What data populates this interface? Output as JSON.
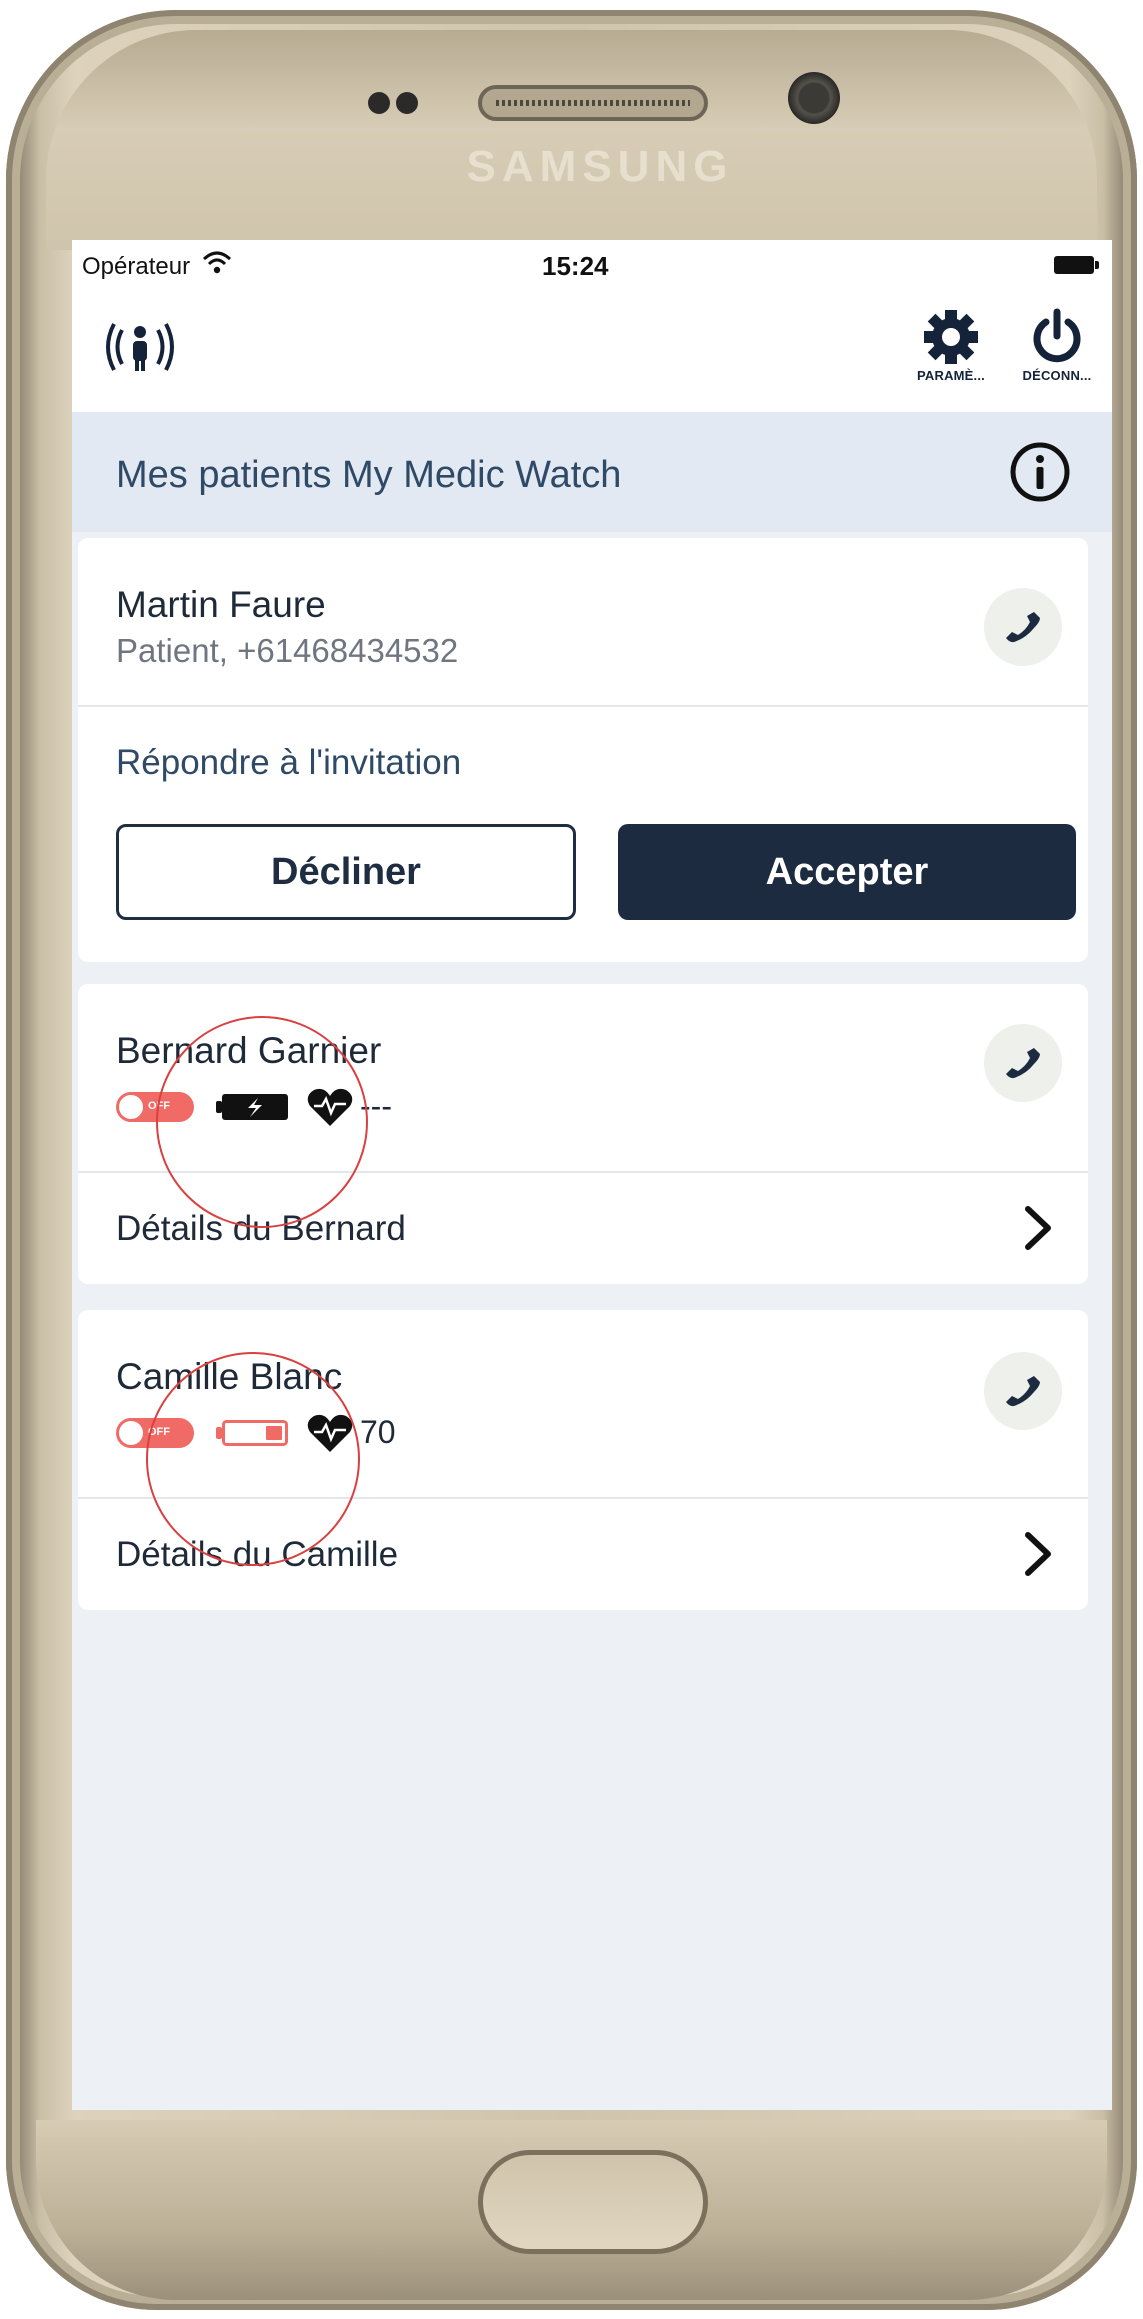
{
  "device": {
    "brand": "SAMSUNG"
  },
  "status_bar": {
    "carrier": "Opérateur",
    "time": "15:24"
  },
  "navbar": {
    "settings_caption": "PARAMÈ...",
    "logout_caption": "DÉCONN..."
  },
  "section": {
    "title": "Mes patients My Medic Watch"
  },
  "invitation": {
    "name": "Martin Faure",
    "subtitle": "Patient, +61468434532",
    "prompt": "Répondre à l'invitation",
    "decline_label": "Décliner",
    "accept_label": "Accepter"
  },
  "patients": [
    {
      "name": "Bernard Garnier",
      "watch_status": "OFF",
      "battery": "charging",
      "heart_rate": "---",
      "details_label": "Détails du Bernard"
    },
    {
      "name": "Camille Blanc",
      "watch_status": "OFF",
      "battery": "low",
      "heart_rate": "70",
      "details_label": "Détails du Camille"
    }
  ],
  "colors": {
    "primary_dark": "#1d2b41",
    "header_bg": "#e3e9f2",
    "screen_bg": "#edf1f6",
    "alert_red": "#f06a66",
    "annotation_red": "#d94040"
  },
  "icons": [
    "wifi-icon",
    "battery-icon",
    "broadcast-person-icon",
    "gear-icon",
    "power-icon",
    "info-icon",
    "phone-icon",
    "chevron-right-icon",
    "heart-pulse-icon",
    "battery-charging-icon",
    "battery-low-icon"
  ]
}
